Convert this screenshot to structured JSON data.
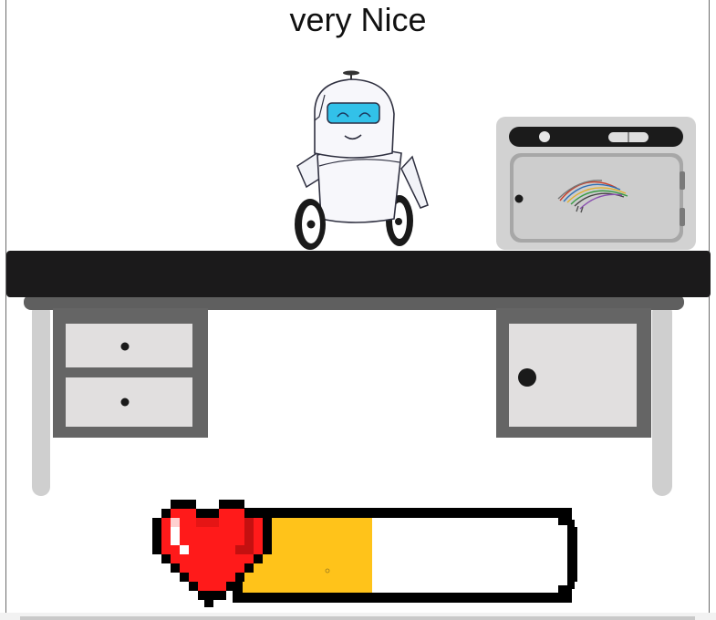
{
  "status_message": "very Nice",
  "progress": {
    "value": 0.4,
    "fill_color": "#ffc31a",
    "empty_color": "#ffffff"
  },
  "icons": {
    "robot": "robot-character",
    "microwave": "microwave-oven",
    "heart": "pixel-heart-icon",
    "wires": "cable-bundle"
  },
  "colors": {
    "desk_top": "#1b1a1b",
    "desk_frame": "#666666",
    "drawer_face": "#e1dfdf",
    "robot_visor": "#32c1e9",
    "heart_red": "#ff1a1a"
  }
}
